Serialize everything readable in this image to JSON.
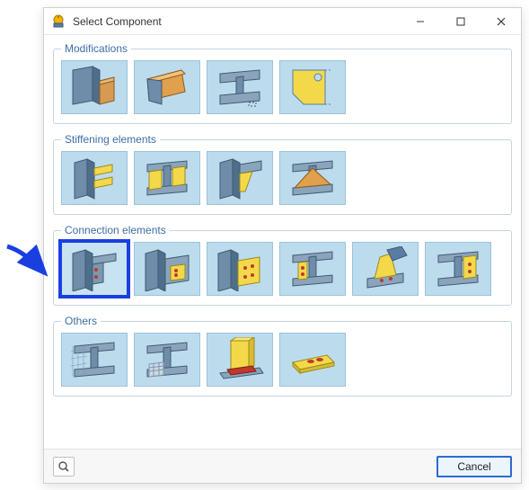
{
  "window": {
    "title": "Select Component"
  },
  "groups": {
    "modifications": {
      "label": "Modifications"
    },
    "stiffening": {
      "label": "Stiffening elements"
    },
    "connection": {
      "label": "Connection elements"
    },
    "others": {
      "label": "Others"
    }
  },
  "footer": {
    "cancel_label": "Cancel"
  }
}
